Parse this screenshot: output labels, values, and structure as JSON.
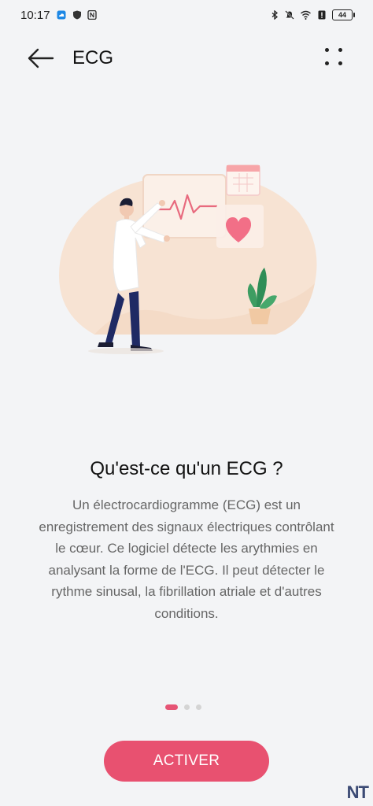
{
  "status_bar": {
    "time": "10:17",
    "battery": "44",
    "icons": [
      "cloud-icon",
      "shield-icon",
      "nfc-icon",
      "bluetooth-icon",
      "mute-icon",
      "wifi-icon",
      "alert-icon",
      "battery-icon"
    ]
  },
  "app_bar": {
    "title": "ECG",
    "back_icon": "arrow-left-icon",
    "more_icon": "more-dots-icon"
  },
  "content": {
    "headline": "Qu'est-ce qu'un ECG ?",
    "description": "Un électrocardiogramme (ECG) est un enregistrement des signaux électriques contrôlant le cœur. Ce logiciel détecte les arythmies en analysant la forme de l'ECG. Il peut détecter le rythme sinusal, la fibrillation atriale et d'autres conditions."
  },
  "pager": {
    "current": 1,
    "total": 3
  },
  "cta": {
    "label": "ACTIVER"
  },
  "watermark": {
    "text": "NT"
  },
  "colors": {
    "accent": "#e85170",
    "background": "#f3f4f6",
    "illustration_blob": "#f7e3d3"
  }
}
